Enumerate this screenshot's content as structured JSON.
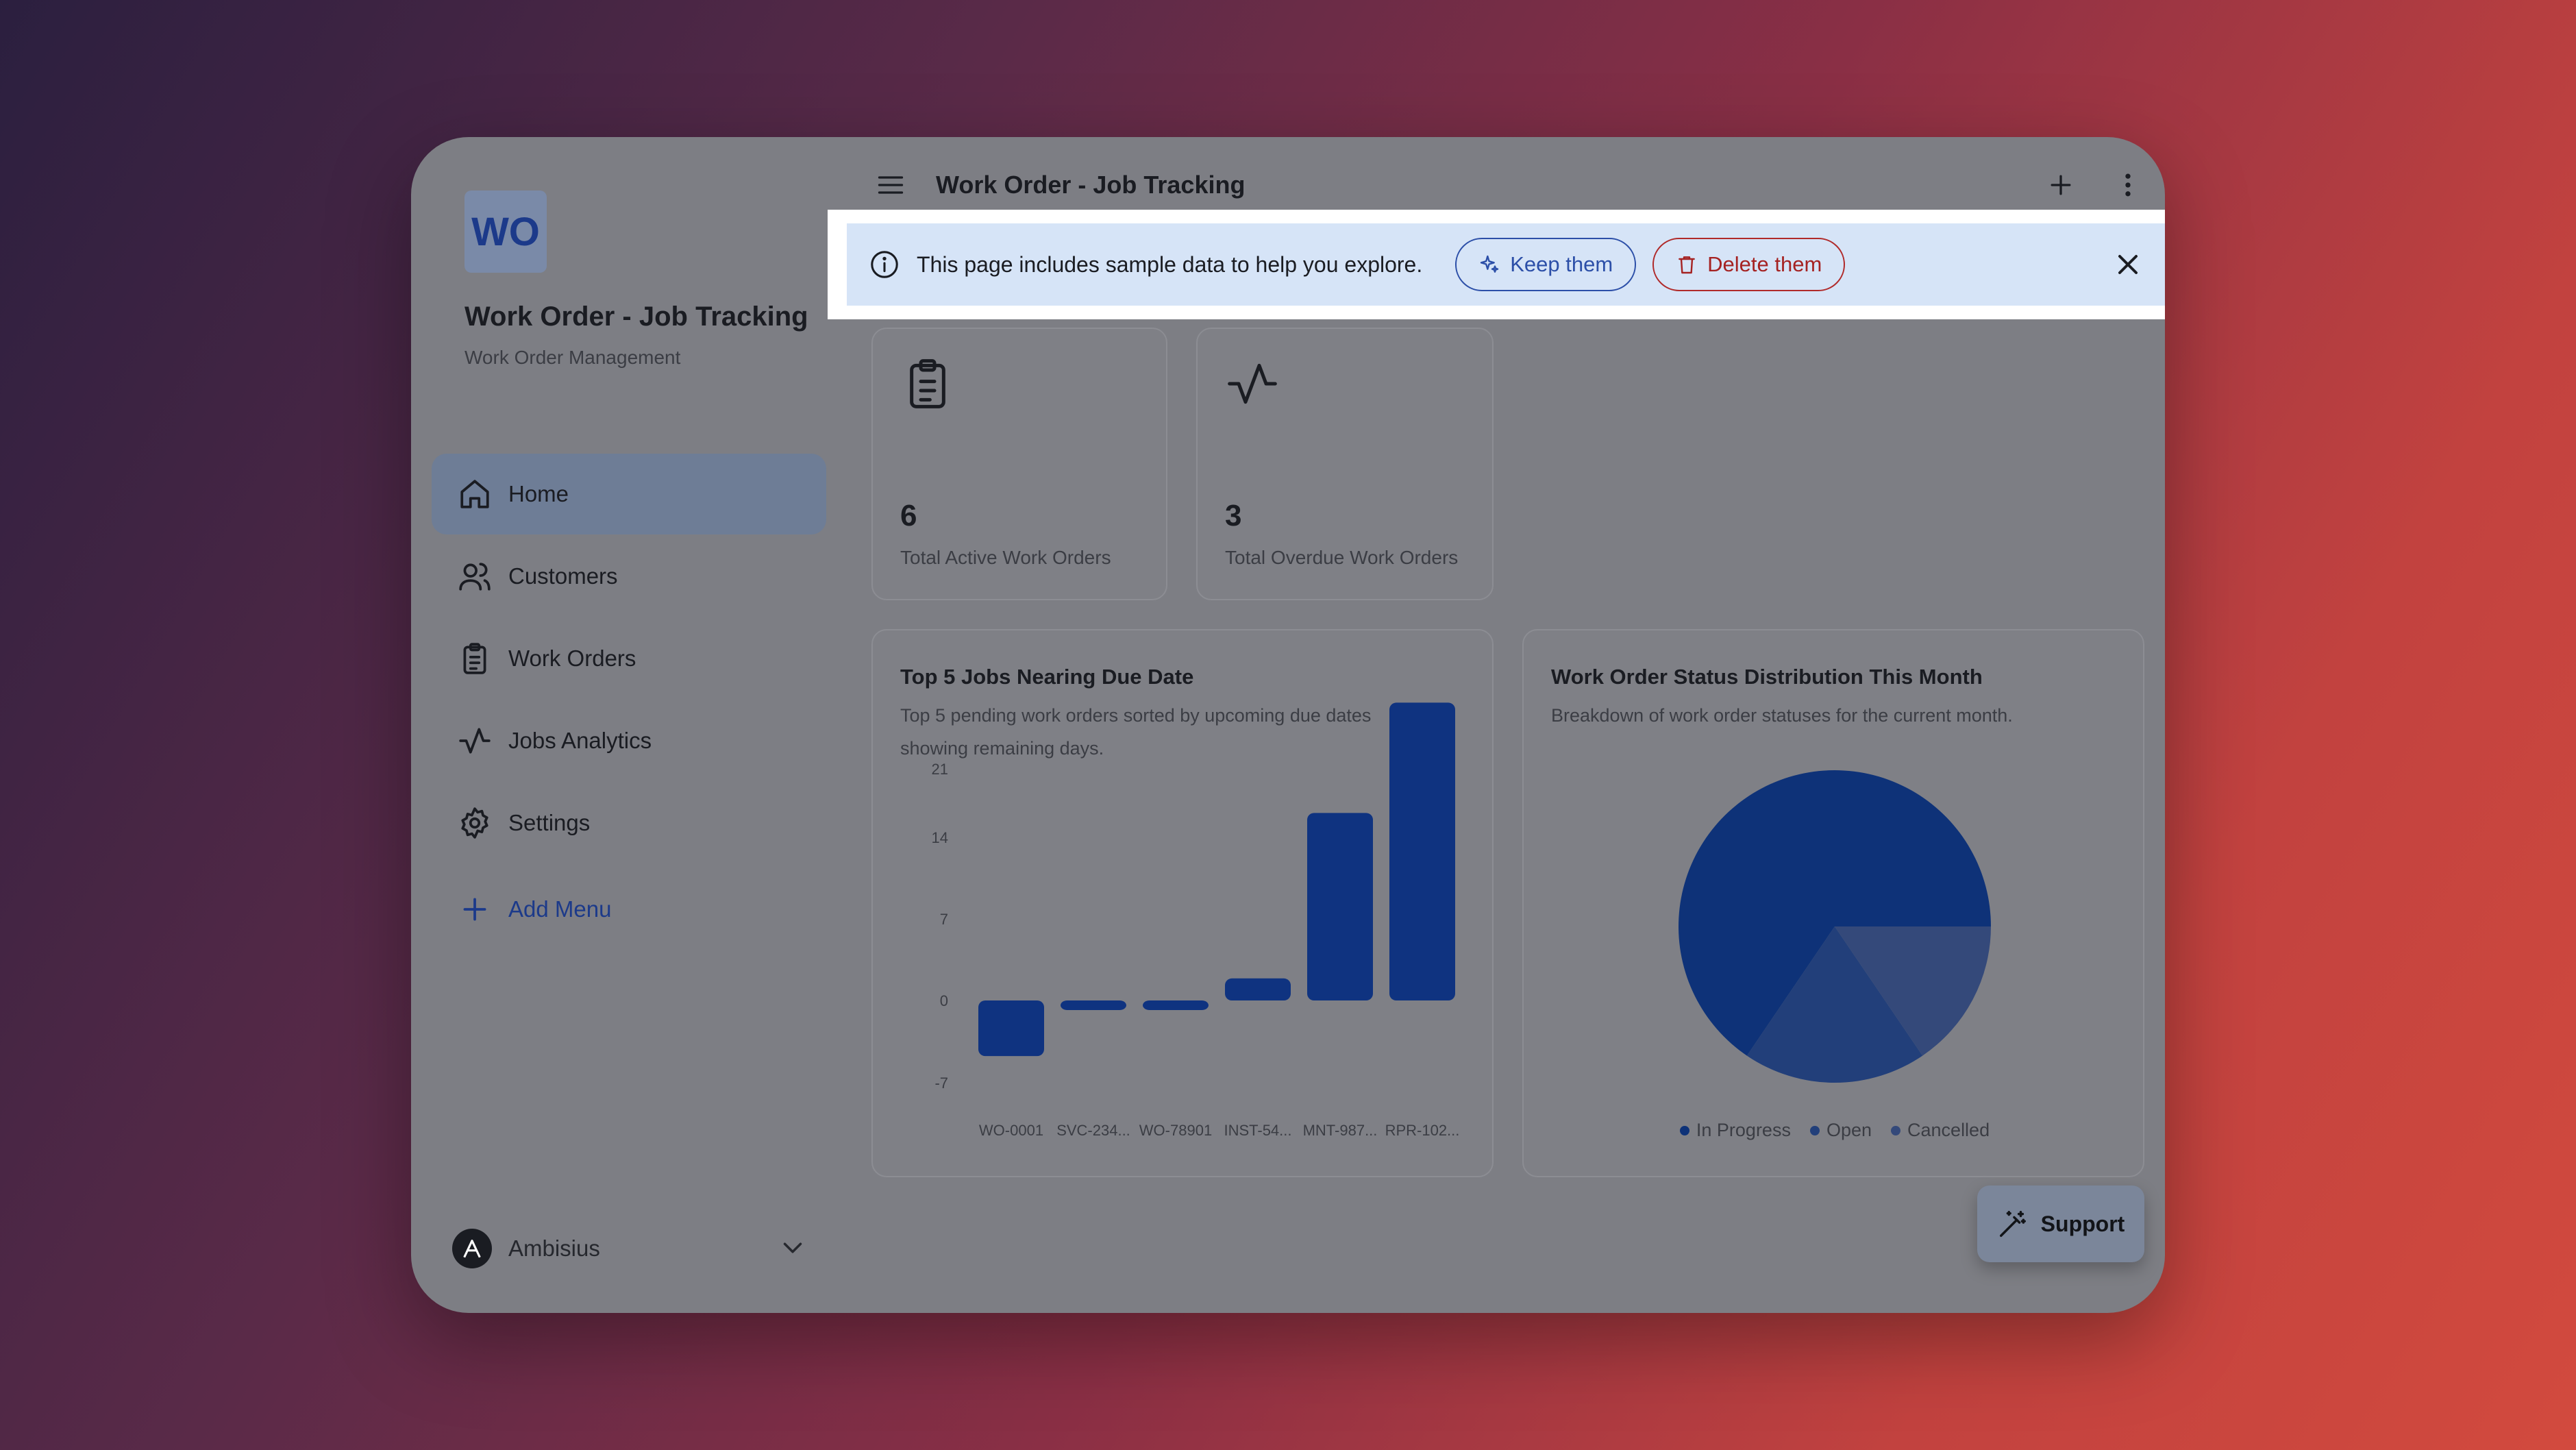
{
  "app": {
    "logo_initials": "WO",
    "title": "Work Order - Job Tracking",
    "subtitle": "Work Order Management"
  },
  "header": {
    "title": "Work Order - Job Tracking"
  },
  "sidebar": {
    "items": [
      {
        "label": "Home",
        "icon": "home-icon",
        "active": true
      },
      {
        "label": "Customers",
        "icon": "users-icon"
      },
      {
        "label": "Work Orders",
        "icon": "clipboard-icon"
      },
      {
        "label": "Jobs Analytics",
        "icon": "activity-icon"
      },
      {
        "label": "Settings",
        "icon": "gear-icon"
      }
    ],
    "add_menu_label": "Add Menu",
    "account_name": "Ambisius"
  },
  "banner": {
    "message": "This page includes sample data to help you explore.",
    "keep_label": "Keep them",
    "delete_label": "Delete them"
  },
  "stats": [
    {
      "value": "6",
      "label": "Total Active Work Orders",
      "icon": "clipboard-icon"
    },
    {
      "value": "3",
      "label": "Total Overdue Work Orders",
      "icon": "activity-icon"
    }
  ],
  "support_label": "Support",
  "colors": {
    "accent": "#1c3a8a",
    "bar": "#0f3380",
    "delete": "#a52222"
  },
  "chart_data": [
    {
      "type": "bar",
      "title": "Top 5 Jobs Nearing Due Date",
      "subtitle": "Top 5 pending work orders sorted by upcoming due dates showing remaining days.",
      "categories": [
        "WO-0001",
        "SVC-234...",
        "WO-78901",
        "INST-54...",
        "MNT-987...",
        "RPR-102..."
      ],
      "values": [
        -7,
        -1,
        -1,
        2,
        17,
        27
      ],
      "yticks": [
        21,
        14,
        7,
        0,
        -7
      ],
      "ylim": [
        -7,
        21
      ],
      "grid": false
    },
    {
      "type": "pie",
      "title": "Work Order Status Distribution This Month",
      "subtitle": "Breakdown of work order statuses for the current month.",
      "slices": [
        {
          "label": "In Progress",
          "value": 6,
          "color": "#0e3278"
        },
        {
          "label": "Open",
          "value": 3,
          "color": "#223f7a"
        },
        {
          "label": "Cancelled",
          "value": 1,
          "color": "#34497a"
        }
      ],
      "legend": "bottom"
    }
  ]
}
